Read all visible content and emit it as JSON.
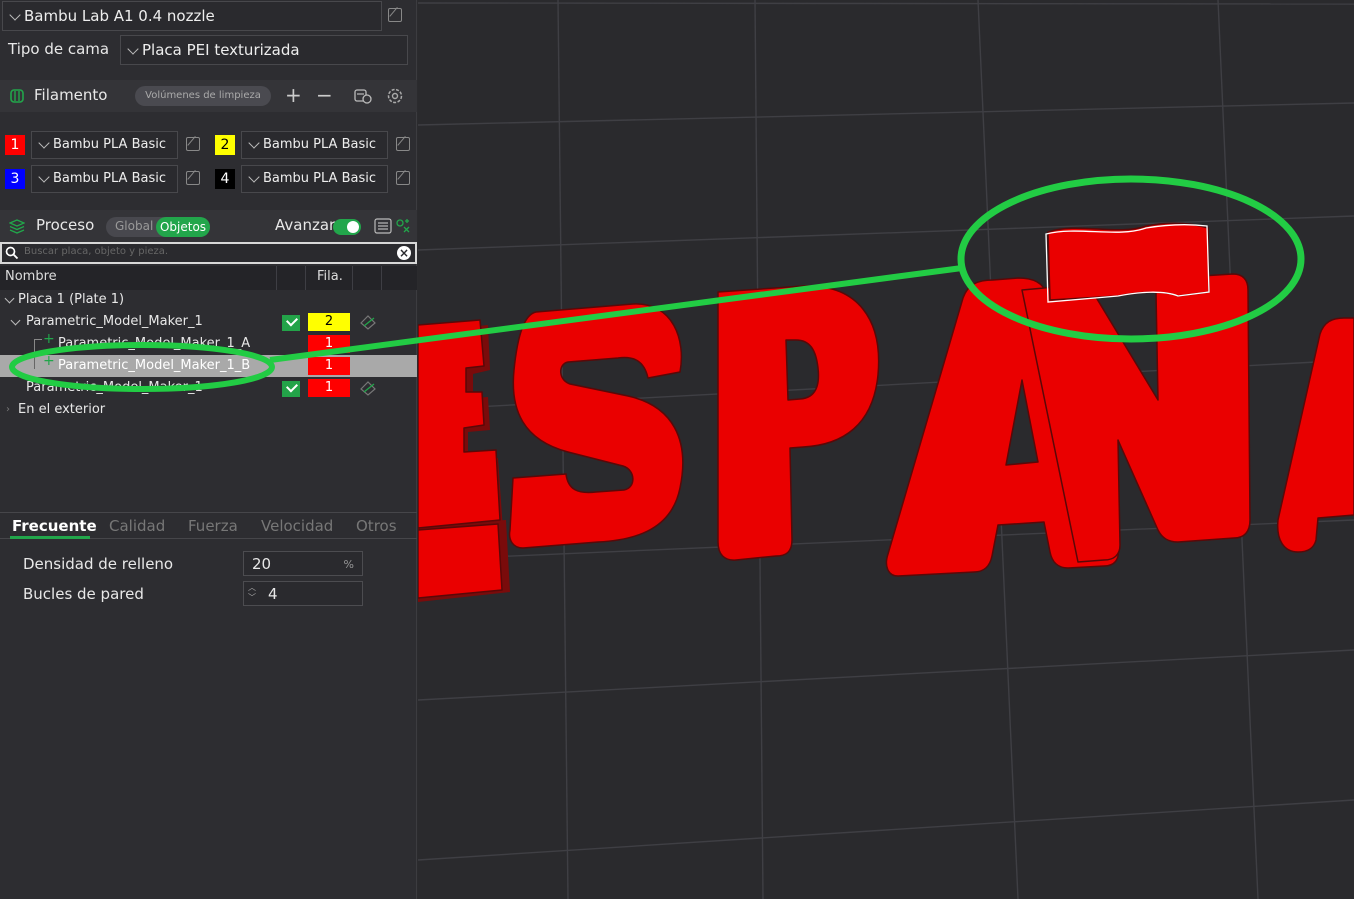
{
  "printer": {
    "name": "Bambu Lab A1 0.4 nozzle"
  },
  "bed": {
    "label": "Tipo de cama",
    "value": "Placa PEI texturizada"
  },
  "filament_section": {
    "title": "Filamento",
    "flush_button": "Volúmenes de limpieza",
    "slots": [
      {
        "num": "1",
        "color": "#ff0000",
        "text_color": "#ffffff",
        "material": "Bambu PLA Basic"
      },
      {
        "num": "2",
        "color": "#ffff00",
        "text_color": "#000000",
        "material": "Bambu PLA Basic"
      },
      {
        "num": "3",
        "color": "#0000ff",
        "text_color": "#ffffff",
        "material": "Bambu PLA Basic"
      },
      {
        "num": "4",
        "color": "#000000",
        "text_color": "#ffffff",
        "material": "Bambu PLA Basic"
      }
    ]
  },
  "process_section": {
    "title": "Proceso",
    "toggle_global": "Global",
    "toggle_objects": "Objetos",
    "advanced_label": "Avanzar",
    "advanced_on": true
  },
  "search": {
    "placeholder": "Buscar placa, objeto y pieza."
  },
  "object_table": {
    "col_name": "Nombre",
    "col_filament": "Fila.",
    "rows": [
      {
        "name": "Placa 1 (Plate 1)"
      },
      {
        "name": "Parametric_Model_Maker_1",
        "filament": "2",
        "filament_color": "#ffff00"
      },
      {
        "name": "Parametric_Model_Maker_1_A",
        "filament": "1",
        "filament_color": "#ff0000"
      },
      {
        "name": "Parametric_Model_Maker_1_B",
        "filament": "1",
        "filament_color": "#ff0000",
        "selected": true
      },
      {
        "name": "Parametric_Model_Maker_1",
        "filament": "1",
        "filament_color": "#ff0000"
      },
      {
        "name": "En el exterior"
      }
    ]
  },
  "settings_tabs": [
    "Frecuente",
    "Calidad",
    "Fuerza",
    "Velocidad",
    "Otros"
  ],
  "settings": {
    "infill_label": "Densidad de relleno",
    "infill_value": "20",
    "infill_unit": "%",
    "walls_label": "Bucles de pared",
    "walls_value": "4"
  },
  "viewport": {
    "model_text": "ESPAÑA",
    "model_color": "#ee0000",
    "annotation_color": "#22cc44"
  }
}
